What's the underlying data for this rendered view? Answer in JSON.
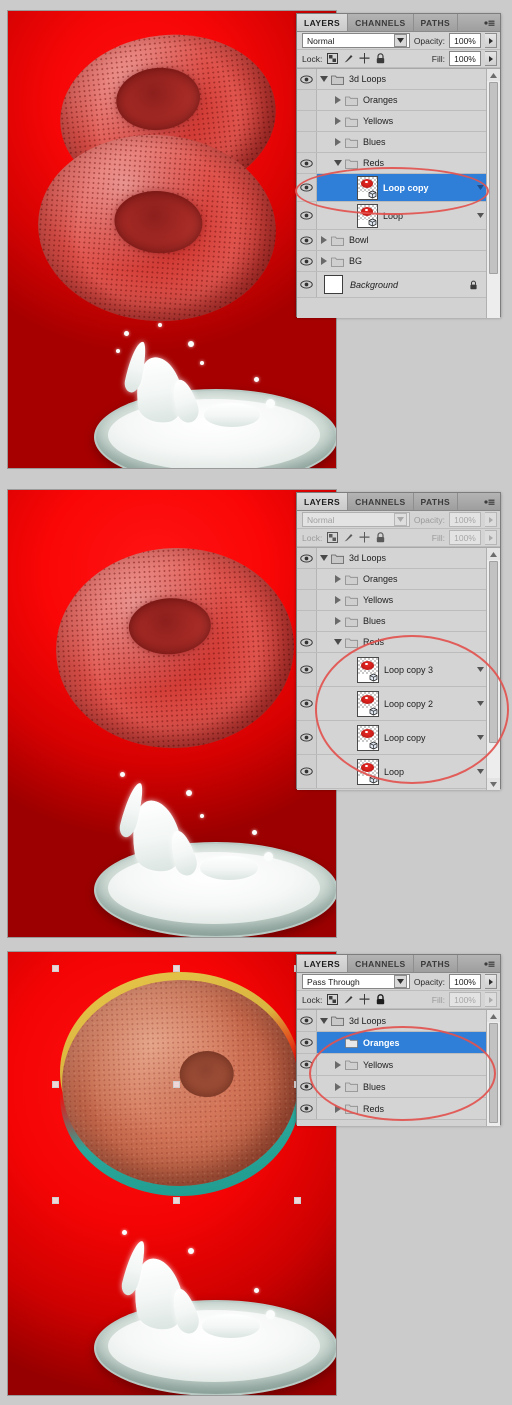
{
  "screenshots": [
    {
      "id": "step-1",
      "canvas": {
        "description": "Two red 3D donut loops over a splashing bowl of milk on a red background"
      },
      "panel": {
        "tabs": [
          {
            "label": "LAYERS",
            "active": true
          },
          {
            "label": "CHANNELS",
            "active": false
          },
          {
            "label": "PATHS",
            "active": false
          }
        ],
        "menu_icon": "panel-menu-icon",
        "blend_mode": "Normal",
        "blend_mode_enabled": true,
        "opacity_label": "Opacity:",
        "opacity_value": "100%",
        "opacity_enabled": true,
        "lock_label": "Lock:",
        "lock_icons": [
          "lock-transparency-icon",
          "lock-image-icon",
          "lock-position-icon",
          "lock-all-icon"
        ],
        "lock_enabled": true,
        "fill_label": "Fill:",
        "fill_value": "100%",
        "fill_enabled": true,
        "layers": [
          {
            "name": "3d Loops",
            "type": "group",
            "indent": 0,
            "visible": true,
            "expanded": true,
            "selected": false,
            "locked": false
          },
          {
            "name": "Oranges",
            "type": "group",
            "indent": 1,
            "visible": false,
            "expanded": false,
            "selected": false,
            "locked": false
          },
          {
            "name": "Yellows",
            "type": "group",
            "indent": 1,
            "visible": false,
            "expanded": false,
            "selected": false,
            "locked": false
          },
          {
            "name": "Blues",
            "type": "group",
            "indent": 1,
            "visible": false,
            "expanded": false,
            "selected": false,
            "locked": false
          },
          {
            "name": "Reds",
            "type": "group",
            "indent": 1,
            "visible": true,
            "expanded": true,
            "selected": false,
            "locked": false
          },
          {
            "name": "Loop copy",
            "type": "smart-object",
            "indent": 2,
            "visible": true,
            "expanded": false,
            "selected": true,
            "locked": false
          },
          {
            "name": "Loop",
            "type": "smart-object",
            "indent": 2,
            "visible": true,
            "expanded": false,
            "selected": false,
            "locked": false
          },
          {
            "name": "Bowl",
            "type": "group",
            "indent": 0,
            "visible": true,
            "expanded": false,
            "selected": false,
            "locked": false
          },
          {
            "name": "BG",
            "type": "group",
            "indent": 0,
            "visible": true,
            "expanded": false,
            "selected": false,
            "locked": false
          },
          {
            "name": "Background",
            "type": "background",
            "indent": 0,
            "visible": true,
            "expanded": false,
            "selected": false,
            "locked": true
          }
        ],
        "annotations": [
          {
            "shape": "ellipse",
            "color": "#e2524f",
            "targets": [
              "Loop copy"
            ]
          }
        ]
      }
    },
    {
      "id": "step-2",
      "canvas": {
        "description": "One large red 3D donut loop over a splashing bowl of milk on a red background"
      },
      "panel": {
        "tabs": [
          {
            "label": "LAYERS",
            "active": true
          },
          {
            "label": "CHANNELS",
            "active": false
          },
          {
            "label": "PATHS",
            "active": false
          }
        ],
        "menu_icon": "panel-menu-icon",
        "blend_mode": "Normal",
        "blend_mode_enabled": false,
        "opacity_label": "Opacity:",
        "opacity_value": "100%",
        "opacity_enabled": false,
        "lock_label": "Lock:",
        "lock_icons": [
          "lock-transparency-icon",
          "lock-image-icon",
          "lock-position-icon",
          "lock-all-icon"
        ],
        "lock_enabled": false,
        "fill_label": "Fill:",
        "fill_value": "100%",
        "fill_enabled": false,
        "layers": [
          {
            "name": "3d Loops",
            "type": "group",
            "indent": 0,
            "visible": true,
            "expanded": true,
            "selected": false,
            "locked": false
          },
          {
            "name": "Oranges",
            "type": "group",
            "indent": 1,
            "visible": false,
            "expanded": false,
            "selected": false,
            "locked": false
          },
          {
            "name": "Yellows",
            "type": "group",
            "indent": 1,
            "visible": false,
            "expanded": false,
            "selected": false,
            "locked": false
          },
          {
            "name": "Blues",
            "type": "group",
            "indent": 1,
            "visible": false,
            "expanded": false,
            "selected": false,
            "locked": false
          },
          {
            "name": "Reds",
            "type": "group",
            "indent": 1,
            "visible": true,
            "expanded": true,
            "selected": false,
            "locked": false
          },
          {
            "name": "Loop copy 3",
            "type": "smart-object",
            "indent": 2,
            "visible": true,
            "expanded": false,
            "selected": false,
            "locked": false
          },
          {
            "name": "Loop copy 2",
            "type": "smart-object",
            "indent": 2,
            "visible": true,
            "expanded": false,
            "selected": false,
            "locked": false
          },
          {
            "name": "Loop copy",
            "type": "smart-object",
            "indent": 2,
            "visible": true,
            "expanded": false,
            "selected": false,
            "locked": false
          },
          {
            "name": "Loop",
            "type": "smart-object",
            "indent": 2,
            "visible": true,
            "expanded": false,
            "selected": false,
            "locked": false
          }
        ],
        "annotations": [
          {
            "shape": "ellipse",
            "color": "#e2524f",
            "targets": [
              "Loop copy 3",
              "Loop copy 2",
              "Loop copy",
              "Loop"
            ]
          }
        ]
      }
    },
    {
      "id": "step-3",
      "canvas": {
        "description": "One large orange-brown 3D donut loop with free-transform handles over a splashing bowl of milk on a red background"
      },
      "panel": {
        "tabs": [
          {
            "label": "LAYERS",
            "active": true
          },
          {
            "label": "CHANNELS",
            "active": false
          },
          {
            "label": "PATHS",
            "active": false
          }
        ],
        "menu_icon": "panel-menu-icon",
        "blend_mode": "Pass Through",
        "blend_mode_enabled": true,
        "opacity_label": "Opacity:",
        "opacity_value": "100%",
        "opacity_enabled": true,
        "lock_label": "Lock:",
        "lock_icons": [
          "lock-transparency-icon",
          "lock-image-icon",
          "lock-position-icon",
          "lock-all-icon"
        ],
        "lock_enabled": true,
        "fill_label": "Fill:",
        "fill_value": "100%",
        "fill_enabled": false,
        "layers": [
          {
            "name": "3d Loops",
            "type": "group",
            "indent": 0,
            "visible": true,
            "expanded": true,
            "selected": false,
            "locked": false
          },
          {
            "name": "Oranges",
            "type": "group",
            "indent": 1,
            "visible": true,
            "expanded": false,
            "selected": true,
            "locked": false
          },
          {
            "name": "Yellows",
            "type": "group",
            "indent": 1,
            "visible": true,
            "expanded": false,
            "selected": false,
            "locked": false
          },
          {
            "name": "Blues",
            "type": "group",
            "indent": 1,
            "visible": true,
            "expanded": false,
            "selected": false,
            "locked": false
          },
          {
            "name": "Reds",
            "type": "group",
            "indent": 1,
            "visible": true,
            "expanded": false,
            "selected": false,
            "locked": false
          }
        ],
        "annotations": [
          {
            "shape": "ellipse",
            "color": "#e2524f",
            "targets": [
              "Oranges",
              "Yellows",
              "Blues",
              "Reds"
            ]
          }
        ]
      }
    }
  ]
}
